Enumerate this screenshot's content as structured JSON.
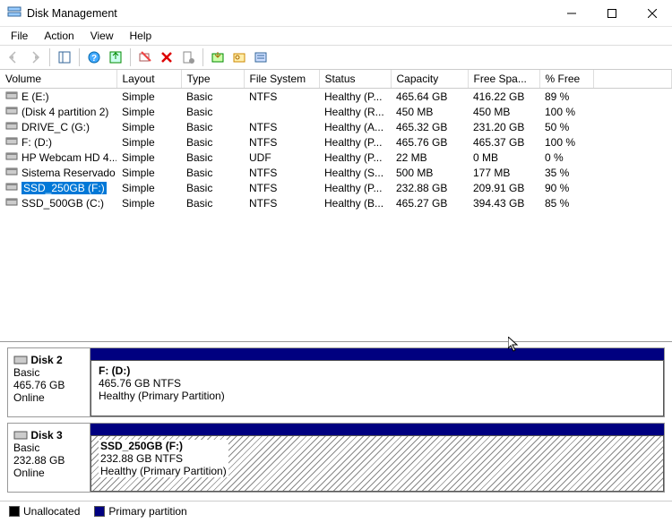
{
  "window": {
    "title": "Disk Management"
  },
  "menu": [
    "File",
    "Action",
    "View",
    "Help"
  ],
  "columns": [
    "Volume",
    "Layout",
    "Type",
    "File System",
    "Status",
    "Capacity",
    "Free Spa...",
    "% Free"
  ],
  "volumes": [
    {
      "name": "E (E:)",
      "layout": "Simple",
      "type": "Basic",
      "fs": "NTFS",
      "status": "Healthy (P...",
      "cap": "465.64 GB",
      "free": "416.22 GB",
      "pct": "89 %"
    },
    {
      "name": "(Disk 4 partition 2)",
      "layout": "Simple",
      "type": "Basic",
      "fs": "",
      "status": "Healthy (R...",
      "cap": "450 MB",
      "free": "450 MB",
      "pct": "100 %"
    },
    {
      "name": "DRIVE_C (G:)",
      "layout": "Simple",
      "type": "Basic",
      "fs": "NTFS",
      "status": "Healthy (A...",
      "cap": "465.32 GB",
      "free": "231.20 GB",
      "pct": "50 %"
    },
    {
      "name": "F: (D:)",
      "layout": "Simple",
      "type": "Basic",
      "fs": "NTFS",
      "status": "Healthy (P...",
      "cap": "465.76 GB",
      "free": "465.37 GB",
      "pct": "100 %"
    },
    {
      "name": "HP Webcam HD 4...",
      "layout": "Simple",
      "type": "Basic",
      "fs": "UDF",
      "status": "Healthy (P...",
      "cap": "22 MB",
      "free": "0 MB",
      "pct": "0 %"
    },
    {
      "name": "Sistema Reservado",
      "layout": "Simple",
      "type": "Basic",
      "fs": "NTFS",
      "status": "Healthy (S...",
      "cap": "500 MB",
      "free": "177 MB",
      "pct": "35 %"
    },
    {
      "name": "SSD_250GB (F:)",
      "layout": "Simple",
      "type": "Basic",
      "fs": "NTFS",
      "status": "Healthy (P...",
      "cap": "232.88 GB",
      "free": "209.91 GB",
      "pct": "90 %",
      "selected": true
    },
    {
      "name": "SSD_500GB (C:)",
      "layout": "Simple",
      "type": "Basic",
      "fs": "NTFS",
      "status": "Healthy (B...",
      "cap": "465.27 GB",
      "free": "394.43 GB",
      "pct": "85 %"
    }
  ],
  "disks": [
    {
      "title": "Disk 2",
      "type": "Basic",
      "size": "465.76 GB",
      "status": "Online",
      "partition": {
        "name": "F:  (D:)",
        "size": "465.76 GB NTFS",
        "status": "Healthy (Primary Partition)",
        "hatch": false
      }
    },
    {
      "title": "Disk 3",
      "type": "Basic",
      "size": "232.88 GB",
      "status": "Online",
      "partition": {
        "name": "SSD_250GB  (F:)",
        "size": "232.88 GB NTFS",
        "status": "Healthy (Primary Partition)",
        "hatch": true
      }
    }
  ],
  "legend": {
    "unallocated": "Unallocated",
    "primary": "Primary partition"
  }
}
